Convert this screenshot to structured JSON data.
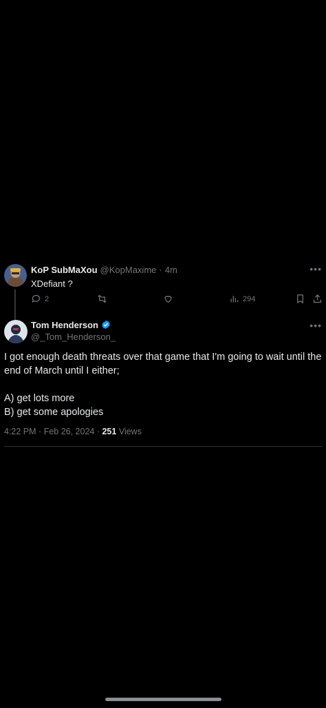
{
  "reply": {
    "name": "KoP SubMaXou",
    "handle": "@KopMaxime",
    "separator": "·",
    "time": "4m",
    "text": "XDefiant ?",
    "reply_count": "2",
    "views": "294"
  },
  "tweet": {
    "name": "Tom Henderson",
    "handle": "@_Tom_Henderson_",
    "lines": [
      "I got enough death threats over that game that I'm going to wait until the end of March until I either;",
      "A) get lots more",
      "B) get some apologies"
    ],
    "time": "4:22 PM",
    "date": "Feb 26, 2024",
    "views_count": "251",
    "views_label": "Views"
  },
  "colors": {
    "background": "#000000",
    "text": "#e7e9ea",
    "muted": "#71767b",
    "verified": "#1d9bf0"
  }
}
